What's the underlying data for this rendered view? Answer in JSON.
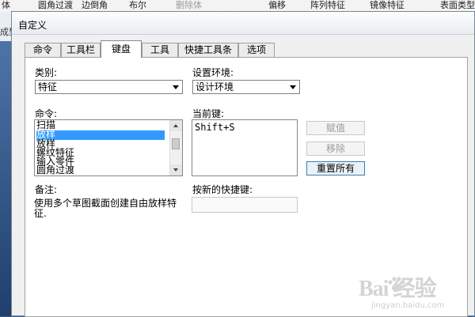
{
  "background_app": {
    "toolbar_items": [
      "体",
      "圆角过渡",
      "边倒角",
      "布尔",
      "删除体",
      "偏移",
      "阵列特征",
      "镜像特征",
      "表面类型"
    ],
    "side_text": [
      "成型"
    ]
  },
  "dialog": {
    "title": "自定义",
    "tabs": [
      {
        "label": "命令",
        "active": false
      },
      {
        "label": "工具栏",
        "active": false
      },
      {
        "label": "键盘",
        "active": true
      },
      {
        "label": "工具",
        "active": false
      },
      {
        "label": "快捷工具条",
        "active": false
      },
      {
        "label": "选项",
        "active": false
      }
    ],
    "category": {
      "label": "类别:",
      "value": "特征"
    },
    "environment": {
      "label": "设置环境:",
      "value": "设计环境"
    },
    "commands": {
      "label": "命令:",
      "items": [
        "扫描",
        "放样",
        "放样",
        "螺纹特征",
        "输入零件",
        "圆角过渡"
      ],
      "selected_index": 1
    },
    "current_keys": {
      "label": "当前键:",
      "items": [
        "Shift+S"
      ]
    },
    "buttons": {
      "assign": "赋值",
      "remove": "移除",
      "reset_all": "重置所有"
    },
    "note": {
      "label": "备注:",
      "text": "使用多个草图截面创建自由放样特征."
    },
    "new_hotkey": {
      "label": "按新的快捷键:",
      "value": ""
    }
  },
  "watermark": {
    "logo": "Bai 经验",
    "url": "jingyan.baidu.com"
  }
}
